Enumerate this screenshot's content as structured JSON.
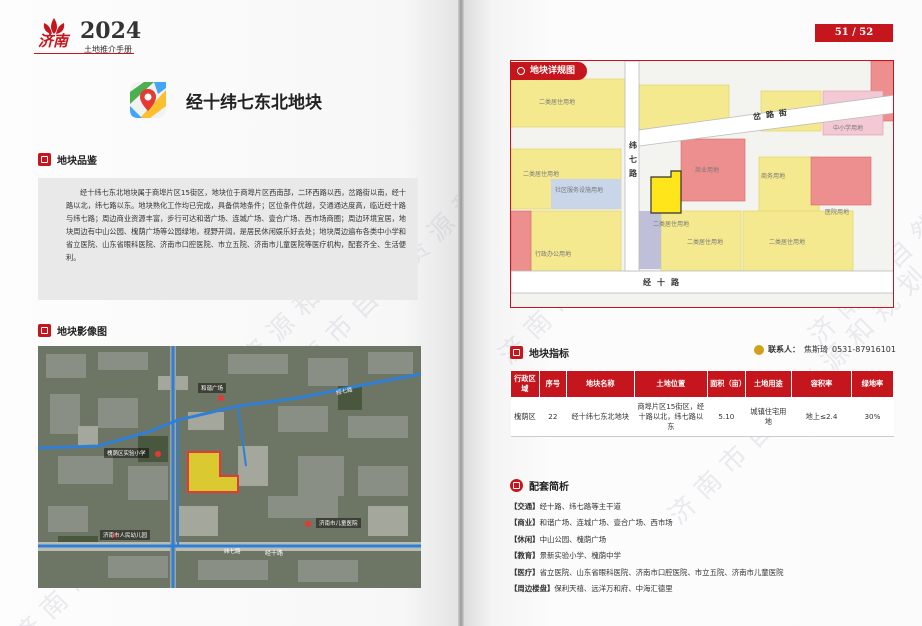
{
  "header": {
    "city": "济南",
    "year": "2024",
    "subtitle": "土地推介手册"
  },
  "plot": {
    "title": "经十纬七东北地块"
  },
  "sections": {
    "overview_title": "地块品鉴",
    "aerial_title": "地块影像图",
    "planning_title": "地块详规图",
    "indicator_title": "地块指标",
    "notes_title": "配套简析"
  },
  "overview_text": "经十纬七东北地块属于商埠片区15街区，地块位于商埠片区西南部，二环西路以西，岔路街以南，经十路以北，纬七路以东。地块熟化工作均已完成，具备供地条件；区位条件优越，交通通达度高，临近经十路与纬七路；周边商业资源丰富，步行可达和谐广场、连城广场、壹合广场、西市场商圈；周边环境宜居，地块周边有中山公园、槐荫广场等公园绿地，视野开阔，是居民休闲娱乐好去处；地块周边遍布各类中小学和省立医院、山东省眼科医院、济南市口腔医院、市立五院、济南市儿童医院等医疗机构，配套齐全、生活便利。",
  "aerial_labels": {
    "plaza": "和谐广场",
    "school": "槐荫区实验小学",
    "road_jingshi": "经十路",
    "road_weiqi": "纬七路",
    "road_jingqi": "经七路",
    "kindergarten": "济南市人民幼儿园",
    "hospital": "济南市儿童医院"
  },
  "page_number": "51 / 52",
  "planning_map": {
    "labels": {
      "chalu": "岔路街",
      "weiqi": "纬七路",
      "jingshi": "经十路",
      "res2_a": "二类居住用地",
      "res2_b": "二类居住用地",
      "res2_c": "二类居住用地",
      "res2_d": "二类居住用地",
      "res2_e": "二类居住用地",
      "commercial": "商业用地",
      "school": "中小学用地",
      "hospital": "医院用地",
      "community": "社区服务设施用地",
      "admin": "行政办公用地",
      "office": "商务用地"
    }
  },
  "contact": {
    "label": "联系人：",
    "name": "焦斯琦",
    "phone": "0531-87916101"
  },
  "indicators": {
    "headers": [
      "行政区域",
      "序号",
      "地块名称",
      "土地位置",
      "面积（亩）",
      "土地用途",
      "容积率",
      "绿地率"
    ],
    "row": [
      "槐荫区",
      "22",
      "经十纬七东北地块",
      "商埠片区15街区，经十路以北，纬七路以东",
      "5.10",
      "城镇住宅用地",
      "地上≤2.4",
      "30%"
    ]
  },
  "notes": [
    {
      "tag": "【交通】",
      "text": "经十路、纬七路等主干道"
    },
    {
      "tag": "【商业】",
      "text": "和谐广场、连城广场、壹合广场、西市场"
    },
    {
      "tag": "【休闲】",
      "text": "中山公园、槐荫广场"
    },
    {
      "tag": "【教育】",
      "text": "景新实验小学、槐荫中学"
    },
    {
      "tag": "【医疗】",
      "text": "省立医院、山东省眼科医院、济南市口腔医院、市立五院、济南市儿童医院"
    },
    {
      "tag": "【周边楼盘】",
      "text": "保利天禧、远洋万和府、中海汇德里"
    }
  ],
  "watermark": "济南市自然资源和规划局",
  "colors": {
    "brand_red": "#c4161c",
    "residential": "#f5e98f",
    "commercial": "#ee8f8f",
    "plot": "#ffe51a"
  }
}
